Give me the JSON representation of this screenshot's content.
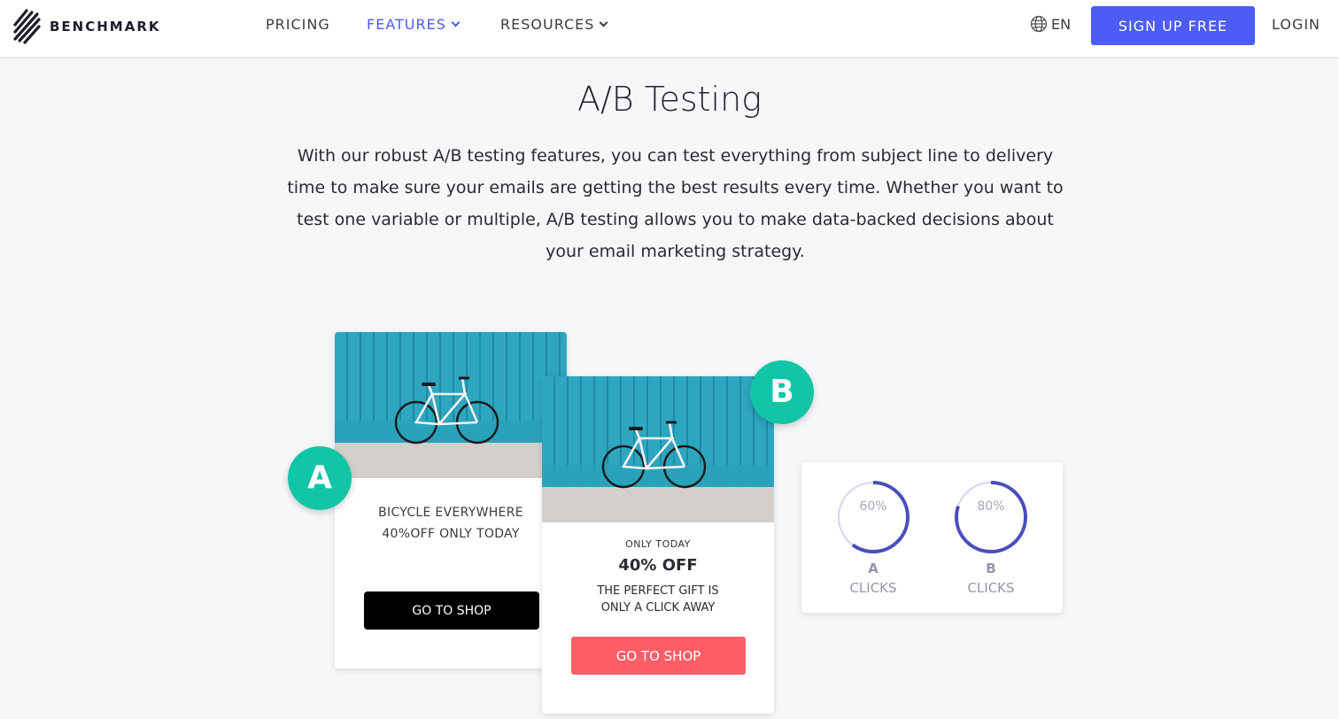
{
  "brand": {
    "name": "BENCHMARK",
    "logo_icon": "benchmark-slash-logo"
  },
  "nav": {
    "pricing": "PRICING",
    "features": "FEATURES",
    "resources": "RESOURCES",
    "active_color": "#4c5cf1"
  },
  "header": {
    "language": "EN",
    "language_icon": "globe-icon",
    "signup": "SIGN UP FREE",
    "login": "LOGIN",
    "accent": "#4d5cf4"
  },
  "main": {
    "title": "A/B Testing",
    "description": "With our robust A/B testing features, you can test everything from subject line to delivery time to make sure your emails are getting the best results every time. Whether you want to test one variable or multiple, A/B testing allows you to make data-backed decisions about your email marketing strategy."
  },
  "variant_a": {
    "badge": "A",
    "line1": "BICYCLE EVERYWHERE",
    "line2": "40%OFF ONLY TODAY",
    "button": "GO TO SHOP",
    "button_color": "#000000"
  },
  "variant_b": {
    "badge": "B",
    "small": "ONLY TODAY",
    "headline": "40% OFF",
    "line1": "THE PERFECT GIFT IS",
    "line2": "ONLY A CLICK AWAY",
    "button": "GO TO SHOP",
    "button_color": "#fe5f67"
  },
  "badge_color": "#11c5a6",
  "stats": {
    "a": {
      "percent_label": "60%",
      "percent": 0.6,
      "letter": "A",
      "metric": "CLICKS"
    },
    "b": {
      "percent_label": "80%",
      "percent": 0.8,
      "letter": "B",
      "metric": "CLICKS"
    },
    "ring_color": "#4a4fbe",
    "track_color": "#d4d4ec"
  }
}
